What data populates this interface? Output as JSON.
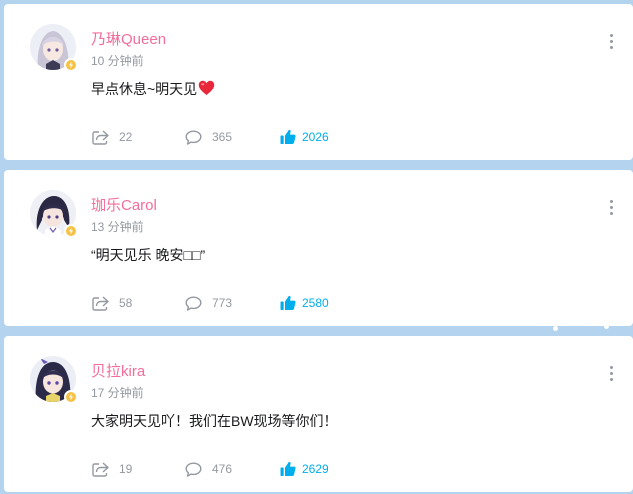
{
  "posts": [
    {
      "username": "乃琳Queen",
      "time": "10 分钟前",
      "content": "早点休息~明天见",
      "content_emoji": "red-heart",
      "shares": "22",
      "comments": "365",
      "likes": "2026"
    },
    {
      "username": "珈乐Carol",
      "time": "13 分钟前",
      "content": "“明天见乐 晚安□□”",
      "shares": "58",
      "comments": "773",
      "likes": "2580"
    },
    {
      "username": "贝拉kira",
      "time": "17 分钟前",
      "content": "大家明天见吖！我们在BW现场等你们！",
      "shares": "19",
      "comments": "476",
      "likes": "2629"
    }
  ],
  "colors": {
    "background": "#b4d3ee",
    "username": "#f36d9b",
    "like_accent": "#00aeec",
    "muted": "#9499a0",
    "badge": "#f6c245"
  },
  "icons": {
    "share": "share-icon",
    "comment": "comment-icon",
    "like": "thumbs-up-icon",
    "more": "more-vertical-icon",
    "verified": "lightning-badge-icon"
  }
}
